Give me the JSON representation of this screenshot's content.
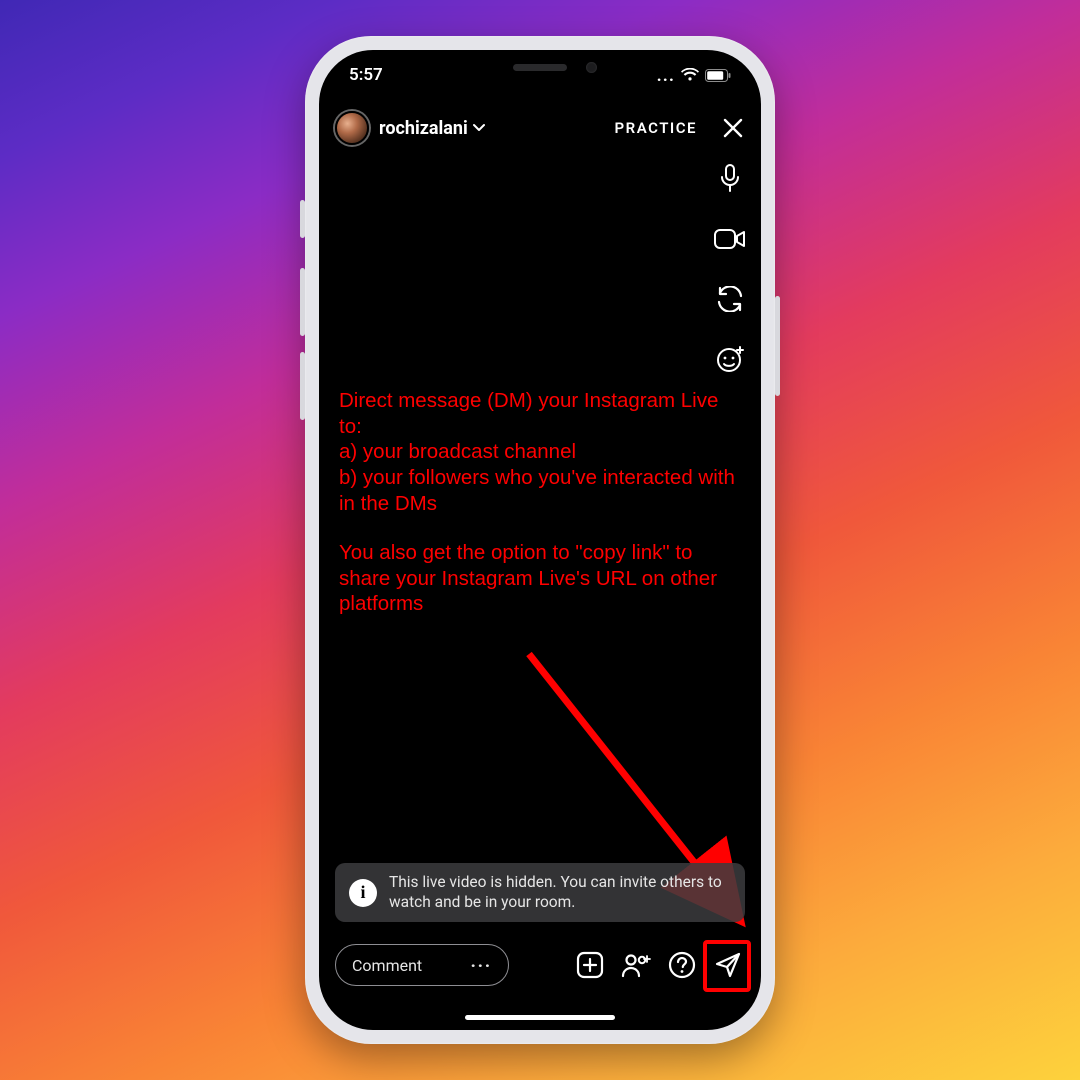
{
  "status": {
    "time": "5:57",
    "signal_icon": "signal-icon",
    "wifi_icon": "wifi-icon",
    "battery_icon": "battery-icon"
  },
  "header": {
    "username": "rochizalani",
    "chevron_icon": "chevron-down-icon",
    "practice_label": "PRACTICE",
    "close_icon": "close-icon"
  },
  "side_tools": {
    "mic_icon": "microphone-icon",
    "video_icon": "video-camera-icon",
    "flip_icon": "camera-flip-icon",
    "face_icon": "face-effect-icon"
  },
  "annotation": {
    "p1": "Direct message (DM) your Instagram Live to:\na) your broadcast channel\nb) your followers who you've interacted with in the DMs",
    "p2": "You also get the option to \"copy link\" to share your Instagram Live's URL on other platforms",
    "arrow_color": "#ff0000"
  },
  "toast": {
    "info_icon": "info-icon",
    "message": "This live video is hidden. You can invite others to watch and be in your room."
  },
  "bottom": {
    "comment_placeholder": "Comment",
    "more_icon": "more-icon",
    "add_media_icon": "add-media-icon",
    "add_guest_icon": "add-person-icon",
    "help_icon": "question-icon",
    "share_icon": "send-icon"
  },
  "colors": {
    "highlight": "#ff0000"
  }
}
